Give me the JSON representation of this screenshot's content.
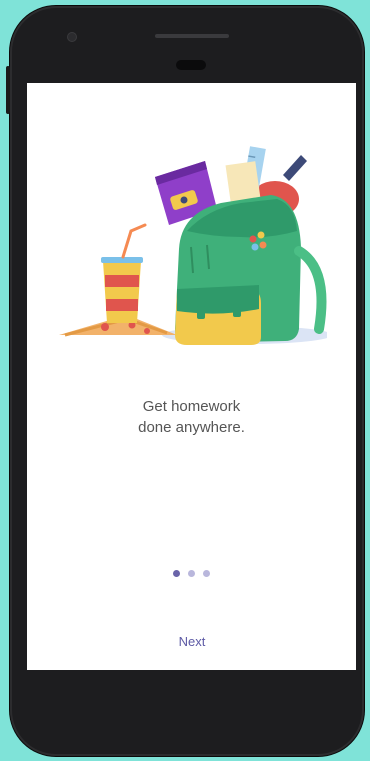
{
  "onboarding": {
    "line1": "Get homework",
    "line2": "done anywhere.",
    "pager": {
      "total": 3,
      "active": 1
    },
    "next_label": "Next"
  },
  "icons": {
    "camera": "front-camera-icon",
    "speaker": "earpiece-icon",
    "sensor": "proximity-sensor-icon"
  },
  "colors": {
    "background": "#7fe3d8",
    "phone": "#1d1d1f",
    "accent": "#5d5aa5",
    "backpack": "#3fb07a"
  }
}
